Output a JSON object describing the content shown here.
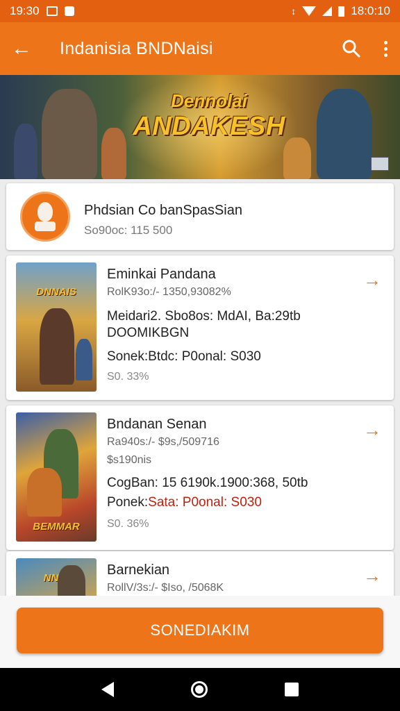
{
  "status_bar": {
    "time_left": "19:30",
    "time_right": "18:0:10"
  },
  "app_bar": {
    "back_icon": "arrow-left-icon",
    "title": "Indanisia BNDNaisi",
    "search_icon": "search-icon",
    "more_icon": "more-vert-icon"
  },
  "banner": {
    "line1": "Dennolai",
    "line2": "ANDAKESH"
  },
  "profile": {
    "name": "Phdsian Co banSpasSian",
    "subtitle": "So90oc: 115 500"
  },
  "games": [
    {
      "thumb_title": "DNNAIS",
      "name": "Eminkai Pandana",
      "meta": "RolK93o:/- 1350,93082%",
      "extra": "",
      "detail1": "Meidari2. Sbo8os: MdAI, Ba:29tb",
      "detail2": "DOOMIKBGN",
      "detail3_prefix": "Sonek:",
      "detail3_red": "",
      "detail3_rest": "Btdc: P0onal: S030",
      "price": "S0. 33%"
    },
    {
      "thumb_title": "BEMMAR",
      "name": "Bndanan Senan",
      "meta": "Ra940s:/- $9s,/509716",
      "extra": "$s190nis",
      "detail1": "CogBan: 15 6190k.1900:368, 50tb",
      "detail2": "",
      "detail3_prefix": "Ponek:",
      "detail3_red": "Sata: P0onal: S030",
      "detail3_rest": "",
      "price": "S0. 36%"
    },
    {
      "thumb_title": "NNIN",
      "name": "Barnekian",
      "meta": "RollV/3s:/- $Iso, /5068K",
      "extra": "",
      "detail1": "",
      "detail2": "",
      "detail3_prefix": "",
      "detail3_red": "",
      "detail3_rest": "",
      "price": ""
    }
  ],
  "cta": {
    "label": "SONEDIAKIM"
  },
  "colors": {
    "status_bar": "#e2600f",
    "app_bar": "#ee7419",
    "accent": "#ee7419",
    "red_text": "#c2200e"
  }
}
